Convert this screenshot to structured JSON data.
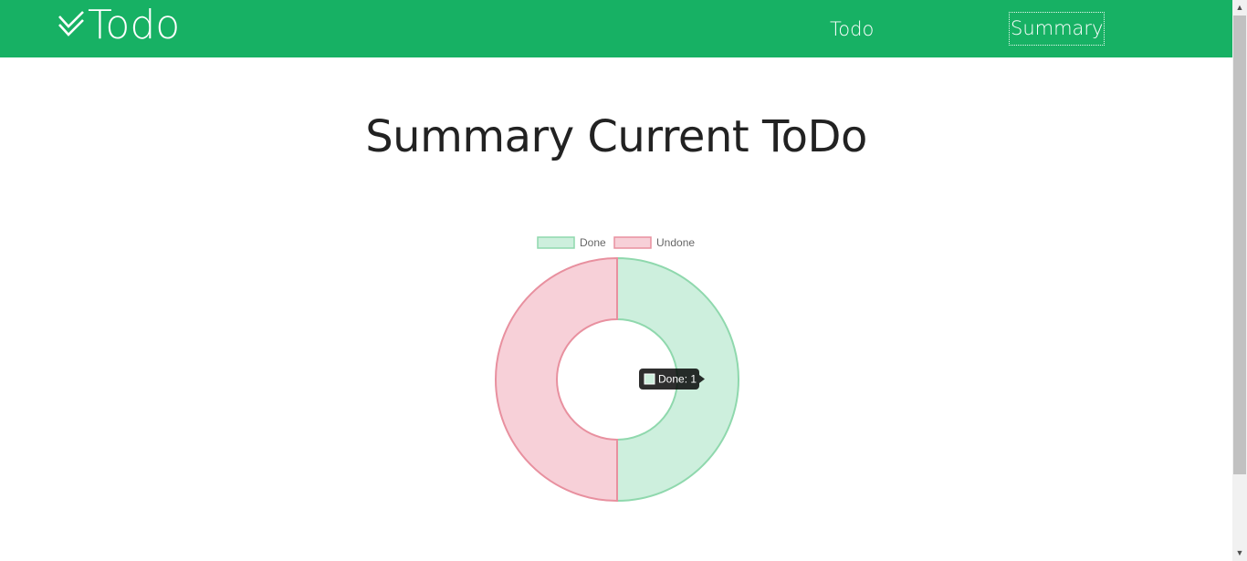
{
  "brand": {
    "name": "Todo",
    "icon": "double-check-icon"
  },
  "nav": {
    "todo_label": "Todo",
    "summary_label": "Summary"
  },
  "page": {
    "title": "Summary Current ToDo"
  },
  "tooltip": {
    "text": "Done: 1"
  },
  "chart_data": {
    "type": "doughnut",
    "categories": [
      "Done",
      "Undone"
    ],
    "values": [
      1,
      1
    ],
    "legend": "top",
    "colors": {
      "Done": {
        "fill": "#cdefdd",
        "border": "#8fd8ad"
      },
      "Undone": {
        "fill": "#f7d0d8",
        "border": "#e8909f"
      }
    }
  },
  "colors": {
    "navbar": "#17b164",
    "title": "#222222"
  }
}
